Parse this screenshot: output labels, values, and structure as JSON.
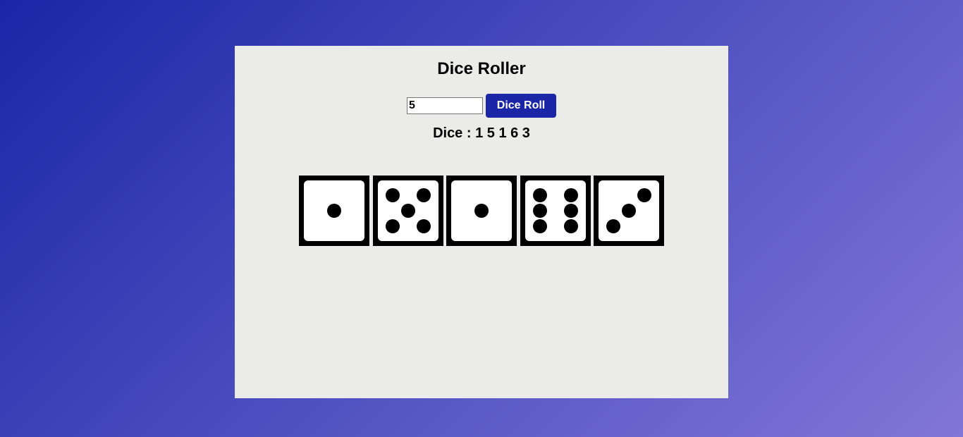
{
  "app": {
    "title": "Dice Roller"
  },
  "controls": {
    "count_value": "5",
    "roll_label": "Dice Roll"
  },
  "result": {
    "label": "Dice : 1 5 1 6 3"
  },
  "dice": [
    1,
    5,
    1,
    6,
    3
  ],
  "colors": {
    "accent": "#1a26a6",
    "card": "#ebebea",
    "die": "#000000",
    "face": "#ffffff"
  }
}
